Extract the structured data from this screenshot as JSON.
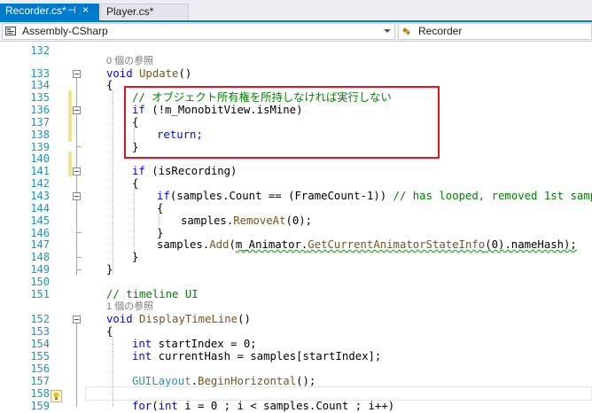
{
  "tabs": [
    {
      "label": "Recorder.cs*",
      "active": true,
      "pin_glyph": "⊣",
      "close_glyph": "×"
    },
    {
      "label": "Player.cs*",
      "active": false
    }
  ],
  "navbar": {
    "project": "Assembly-CSharp",
    "member": "Recorder"
  },
  "colors": {
    "accent": "#007acc",
    "keyword": "#0000ff",
    "method": "#74531f",
    "comment": "#008000",
    "line_number": "#2b91af",
    "highlight_box": "#e8141c"
  },
  "line_numbers": [
    "132",
    "133",
    "134",
    "135",
    "136",
    "137",
    "138",
    "139",
    "140",
    "141",
    "142",
    "143",
    "144",
    "145",
    "146",
    "147",
    "148",
    "149",
    "150",
    "151",
    "152",
    "153",
    "154",
    "155",
    "156",
    "157",
    "158",
    "159"
  ],
  "code_lens": {
    "update_refs": "0 個の参照",
    "display_refs": "1 個の参照"
  },
  "code": {
    "l133_kw": "void",
    "l133_name": "Update",
    "l133_rest": "()",
    "l134": "{",
    "l135": "// オブジェクト所有権を所持しなければ実行しない",
    "l136_kw": "if",
    "l136_rest": " (!m_MonobitView.isMine)",
    "l137": "{",
    "l138": "return;",
    "l139": "}",
    "l141_kw": "if",
    "l141_rest": " (isRecording)",
    "l142": "{",
    "l143_kw": "if",
    "l143_a": "(samples.",
    "l143_b": "Count",
    "l143_c": " == (FrameCount-1)) ",
    "l143_cm": "// has looped, removed 1st sample",
    "l144": "{",
    "l145_a": "samples.",
    "l145_m": "RemoveAt",
    "l145_b": "(0);",
    "l146": "}",
    "l147_a": "samples.",
    "l147_m": "Add",
    "l147_b": "(",
    "l147_c": "m_Animator.",
    "l147_m2": "GetCurrentAnimatorStateInfo",
    "l147_d": "(0).nameHash);",
    "l148": "}",
    "l149": "}",
    "l151": "// timeline UI",
    "l152_kw": "void",
    "l152_name": "DisplayTimeLine",
    "l152_rest": "()",
    "l153": "{",
    "l154_kw": "int",
    "l154_rest": " startIndex = 0;",
    "l155_kw": "int",
    "l155_rest": " currentHash = samples[startIndex];",
    "l157_t": "GUILayout",
    "l157_dot": ".",
    "l157_m": "BeginHorizontal",
    "l157_rest": "();",
    "l159_kw": "for",
    "l159_a": "(",
    "l159_kw2": "int",
    "l159_rest": " i = 0 ; i < samples.Count ; i++)"
  }
}
